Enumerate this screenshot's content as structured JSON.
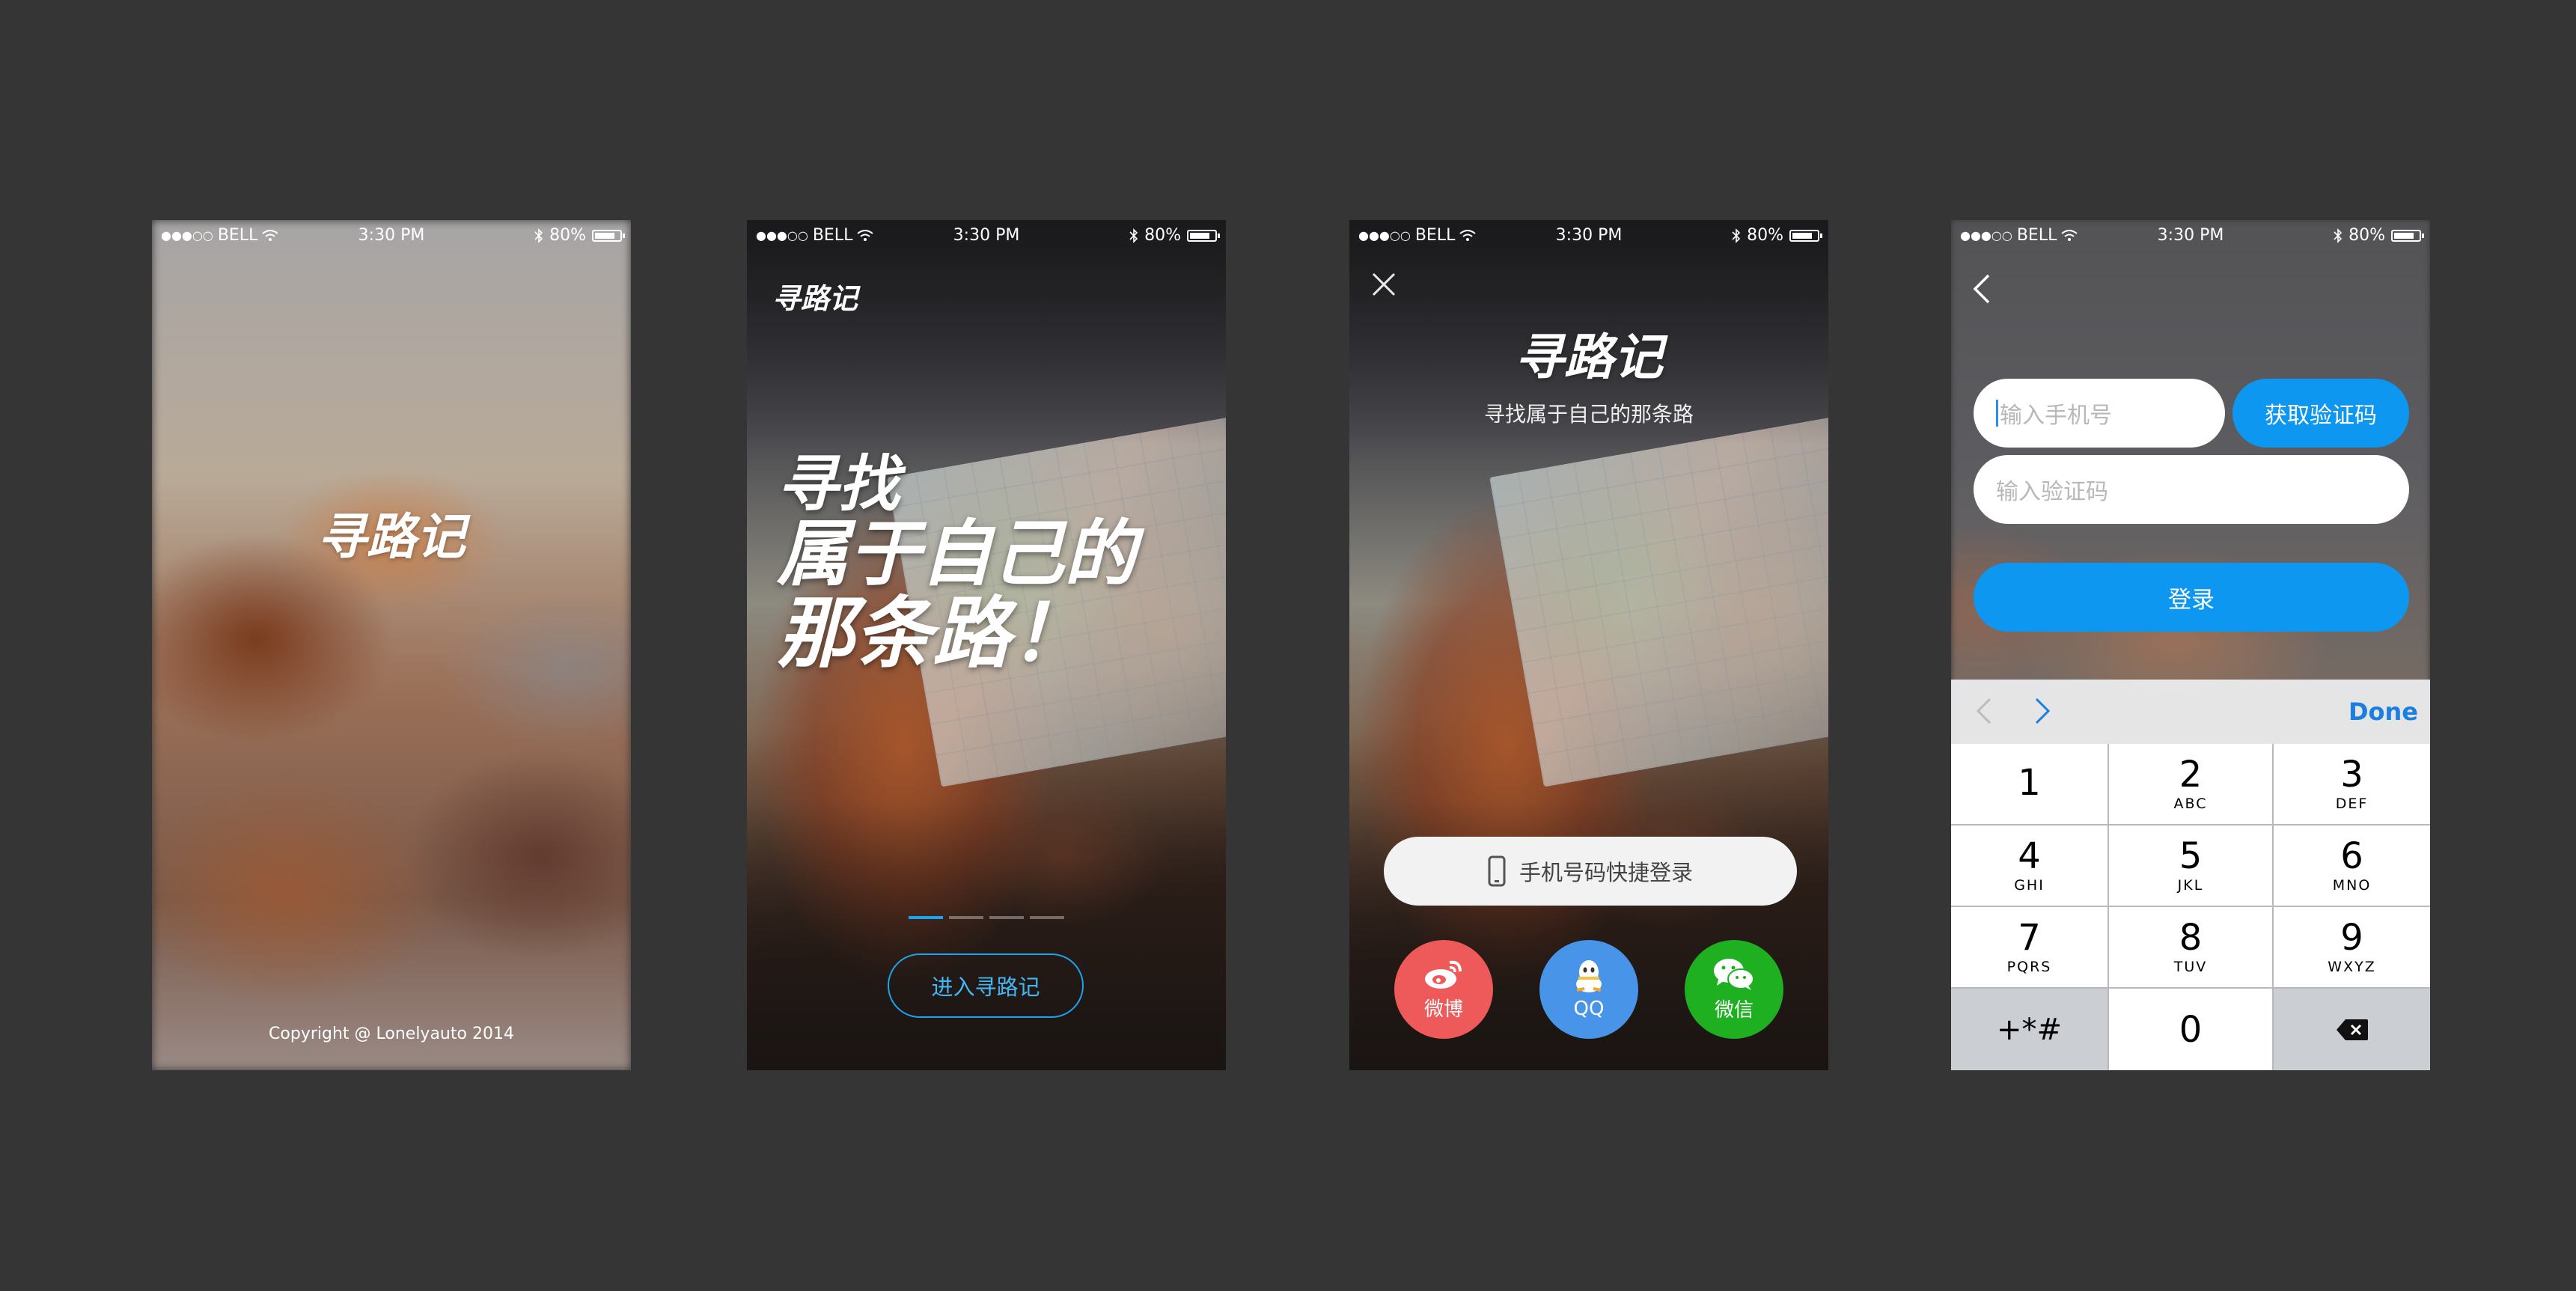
{
  "status_bar": {
    "carrier": "BELL",
    "time": "3:30 PM",
    "battery": "80%",
    "battery_level": 0.8
  },
  "screen1": {
    "logo": "寻路记",
    "copyright": "Copyright @ Lonelyauto 2014"
  },
  "screen2": {
    "logo": "寻路记",
    "slogan_line1": "寻找",
    "slogan_line2": "属于自己的",
    "slogan_line3": "那条路！",
    "pager": {
      "count": 4,
      "active": 0
    },
    "enter_button": "进入寻路记"
  },
  "screen3": {
    "logo": "寻路记",
    "subtitle": "寻找属于自己的那条路",
    "phone_login": "手机号码快捷登录",
    "social": [
      {
        "label": "微博"
      },
      {
        "label": "QQ"
      },
      {
        "label": "微信"
      }
    ],
    "colors": {
      "weibo": "#ee5a5a",
      "qq": "#4794e8",
      "wechat": "#1fb021"
    }
  },
  "screen4": {
    "phone_placeholder": "输入手机号",
    "code_button": "获取验证码",
    "code_placeholder": "输入验证码",
    "login_button": "登录",
    "keyboard": {
      "done": "Done",
      "keys": [
        {
          "num": "1",
          "letters": ""
        },
        {
          "num": "2",
          "letters": "ABC"
        },
        {
          "num": "3",
          "letters": "DEF"
        },
        {
          "num": "4",
          "letters": "GHI"
        },
        {
          "num": "5",
          "letters": "JKL"
        },
        {
          "num": "6",
          "letters": "MNO"
        },
        {
          "num": "7",
          "letters": "PQRS"
        },
        {
          "num": "8",
          "letters": "TUV"
        },
        {
          "num": "9",
          "letters": "WXYZ"
        }
      ],
      "symbols": "+*#",
      "zero": "0"
    },
    "accent_color": "#0d97f0"
  }
}
